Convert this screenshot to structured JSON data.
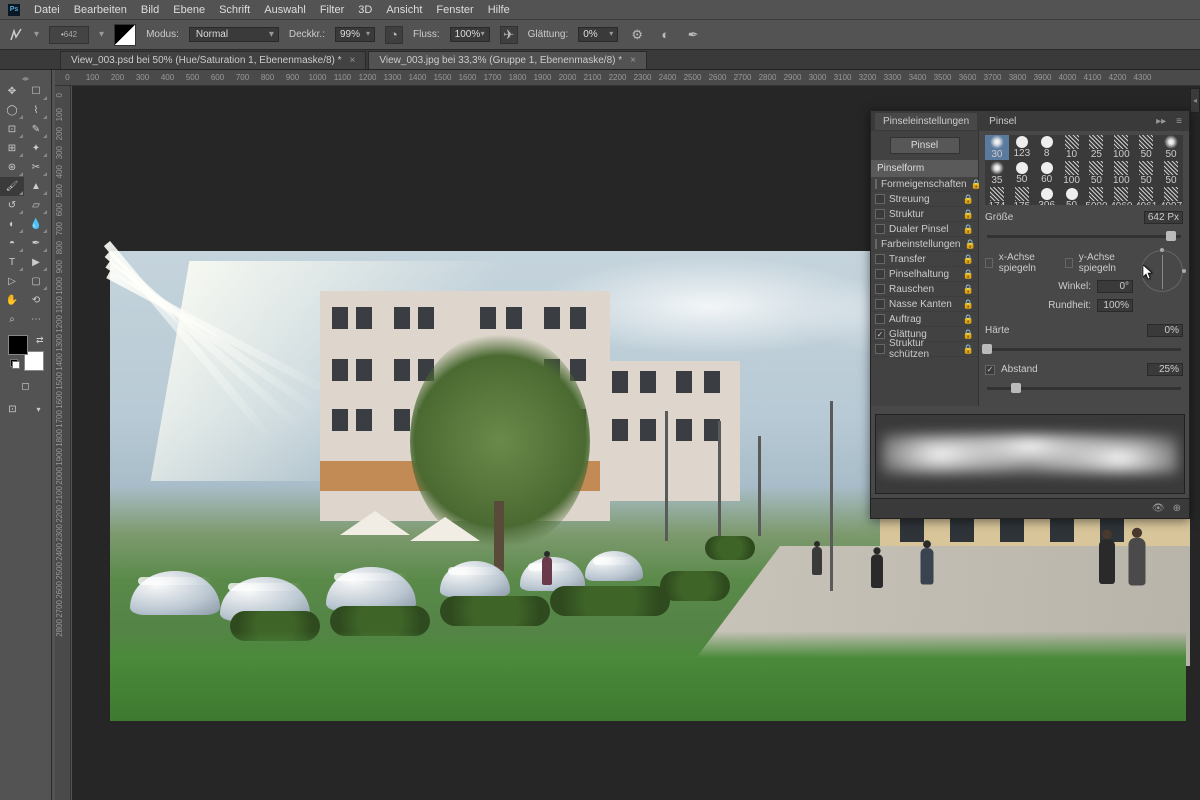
{
  "menu": [
    "Datei",
    "Bearbeiten",
    "Bild",
    "Ebene",
    "Schrift",
    "Auswahl",
    "Filter",
    "3D",
    "Ansicht",
    "Fenster",
    "Hilfe"
  ],
  "options": {
    "brush_size": "642",
    "mode_lbl": "Modus:",
    "mode_val": "Normal",
    "opacity_lbl": "Deckkr.:",
    "opacity_val": "99%",
    "flow_lbl": "Fluss:",
    "flow_val": "100%",
    "smooth_lbl": "Glättung:",
    "smooth_val": "0%"
  },
  "tabs": [
    {
      "title": "View_003.psd bei 50% (Hue/Saturation 1, Ebenenmaske/8) *",
      "active": false
    },
    {
      "title": "View_003.jpg bei 33,3% (Gruppe 1, Ebenenmaske/8) *",
      "active": true
    }
  ],
  "ruler_h": [
    0,
    100,
    200,
    300,
    400,
    500,
    600,
    700,
    800,
    900,
    1000,
    1100,
    1200,
    1300,
    1400,
    1500,
    1600,
    1700,
    1800,
    1900,
    2000,
    2100,
    2200,
    2300,
    2400,
    2500,
    2600,
    2700,
    2800,
    2900,
    3000,
    3100,
    3200,
    3300,
    3400,
    3500,
    3600,
    3700,
    3800,
    3900,
    4000,
    4100,
    4200,
    4300
  ],
  "ruler_v": [
    0,
    100,
    200,
    300,
    400,
    500,
    600,
    700,
    800,
    900,
    1000,
    1100,
    1200,
    1300,
    1400,
    1500,
    1600,
    1700,
    1800,
    1900,
    2000,
    2100,
    2200,
    2300,
    2400,
    2500,
    2600,
    2700,
    2800
  ],
  "tools": [
    [
      "move",
      "artboard"
    ],
    [
      "marq-rect",
      "lasso"
    ],
    [
      "wand",
      "crop"
    ],
    [
      "frame",
      "eyedrop"
    ],
    [
      "heal",
      "brush"
    ],
    [
      "stamp",
      "history"
    ],
    [
      "eraser",
      "gradient"
    ],
    [
      "blur",
      "dodge"
    ],
    [
      "pen",
      "type"
    ],
    [
      "path",
      "rect"
    ],
    [
      "hand",
      "rotate"
    ],
    [
      "zoom",
      "extra"
    ]
  ],
  "panel": {
    "tabs": [
      "Pinseleinstellungen",
      "Pinsel"
    ],
    "active_tab": 0,
    "btn": "Pinsel",
    "section": "Pinselform",
    "checks": [
      {
        "label": "Formeigenschaften",
        "on": false,
        "lock": true
      },
      {
        "label": "Streuung",
        "on": false,
        "lock": true
      },
      {
        "label": "Struktur",
        "on": false,
        "lock": true
      },
      {
        "label": "Dualer Pinsel",
        "on": false,
        "lock": true
      },
      {
        "label": "Farbeinstellungen",
        "on": false,
        "lock": true
      },
      {
        "label": "Transfer",
        "on": false,
        "lock": true
      },
      {
        "label": "Pinselhaltung",
        "on": false,
        "lock": true
      },
      {
        "label": "Rauschen",
        "on": false,
        "lock": true
      },
      {
        "label": "Nasse Kanten",
        "on": false,
        "lock": true
      },
      {
        "label": "Auftrag",
        "on": false,
        "lock": true
      },
      {
        "label": "Glättung",
        "on": true,
        "lock": true
      },
      {
        "label": "Struktur schützen",
        "on": false,
        "lock": true
      }
    ],
    "brushes": [
      {
        "n": "30",
        "k": "soft",
        "sel": true
      },
      {
        "n": "123",
        "k": "hard"
      },
      {
        "n": "8",
        "k": "hard"
      },
      {
        "n": "10",
        "k": "tex"
      },
      {
        "n": "25",
        "k": "tex"
      },
      {
        "n": "100",
        "k": "tex"
      },
      {
        "n": "50",
        "k": "tex"
      },
      {
        "n": "50",
        "k": "soft"
      },
      {
        "n": "35",
        "k": "soft"
      },
      {
        "n": "50",
        "k": "hard"
      },
      {
        "n": "60",
        "k": "hard"
      },
      {
        "n": "100",
        "k": "tex"
      },
      {
        "n": "50",
        "k": "tex"
      },
      {
        "n": "100",
        "k": "tex"
      },
      {
        "n": "50",
        "k": "tex"
      },
      {
        "n": "50",
        "k": "tex"
      },
      {
        "n": "174",
        "k": "tex"
      },
      {
        "n": "175",
        "k": "tex"
      },
      {
        "n": "306",
        "k": "hard"
      },
      {
        "n": "50",
        "k": "hard"
      },
      {
        "n": "5000",
        "k": "tex"
      },
      {
        "n": "4960",
        "k": "tex"
      },
      {
        "n": "4961",
        "k": "tex"
      },
      {
        "n": "4997",
        "k": "tex"
      }
    ],
    "size_lbl": "Größe",
    "size_val": "642 Px",
    "flipx": "x-Achse spiegeln",
    "flipy": "y-Achse spiegeln",
    "angle_lbl": "Winkel:",
    "angle_val": "0°",
    "round_lbl": "Rundheit:",
    "round_val": "100%",
    "hard_lbl": "Härte",
    "hard_val": "0%",
    "spacing_lbl": "Abstand",
    "spacing_val": "25%"
  }
}
